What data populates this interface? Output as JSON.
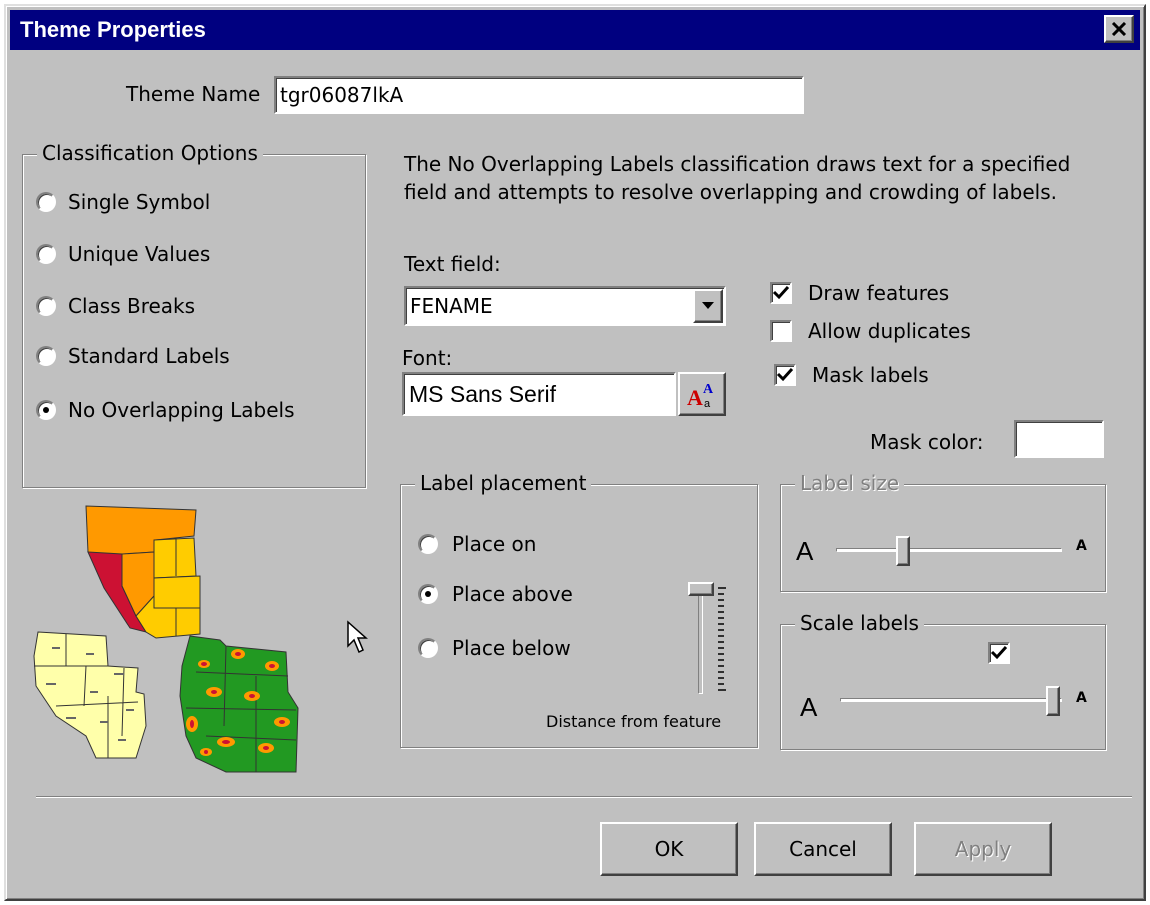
{
  "window": {
    "title": "Theme Properties"
  },
  "theme_name": {
    "label": "Theme Name",
    "value": "tgr06087lkA"
  },
  "classification": {
    "title": "Classification Options",
    "options": [
      {
        "label": "Single Symbol",
        "selected": false
      },
      {
        "label": "Unique Values",
        "selected": false
      },
      {
        "label": "Class Breaks",
        "selected": false
      },
      {
        "label": "Standard Labels",
        "selected": false
      },
      {
        "label": "No Overlapping Labels",
        "selected": true
      }
    ]
  },
  "description": {
    "line1": "The No Overlapping Labels classification draws text for a specified",
    "line2": "field and attempts to resolve overlapping and crowding of labels."
  },
  "text_field": {
    "label": "Text field:",
    "value": "FENAME"
  },
  "font": {
    "label": "Font:",
    "value": "MS Sans Serif",
    "button_icon": "font-picker-icon"
  },
  "checkboxes": {
    "draw_features": {
      "label": "Draw features",
      "checked": true
    },
    "allow_duplicates": {
      "label": "Allow duplicates",
      "checked": false
    },
    "mask_labels": {
      "label": "Mask labels",
      "checked": true
    }
  },
  "mask_color": {
    "label": "Mask color:",
    "value": "#ffffff"
  },
  "label_placement": {
    "title": "Label placement",
    "options": [
      {
        "label": "Place on",
        "selected": false
      },
      {
        "label": "Place above",
        "selected": true
      },
      {
        "label": "Place below",
        "selected": false
      }
    ],
    "slider_caption": "Distance from feature"
  },
  "label_size": {
    "title": "Label size",
    "small_glyph": "A",
    "large_glyph": "A",
    "enabled": false
  },
  "scale_labels": {
    "title": "Scale labels",
    "checked": true,
    "small_glyph": "A",
    "large_glyph": "A"
  },
  "buttons": {
    "ok": "OK",
    "cancel": "Cancel",
    "apply": "Apply"
  },
  "colors": {
    "face": "#c0c0c0",
    "titlebar": "#000080",
    "map_orange": "#ff9900",
    "map_red": "#cc1133",
    "map_yellow": "#ffcc00",
    "map_cream": "#ffffaa",
    "map_green": "#229922"
  }
}
